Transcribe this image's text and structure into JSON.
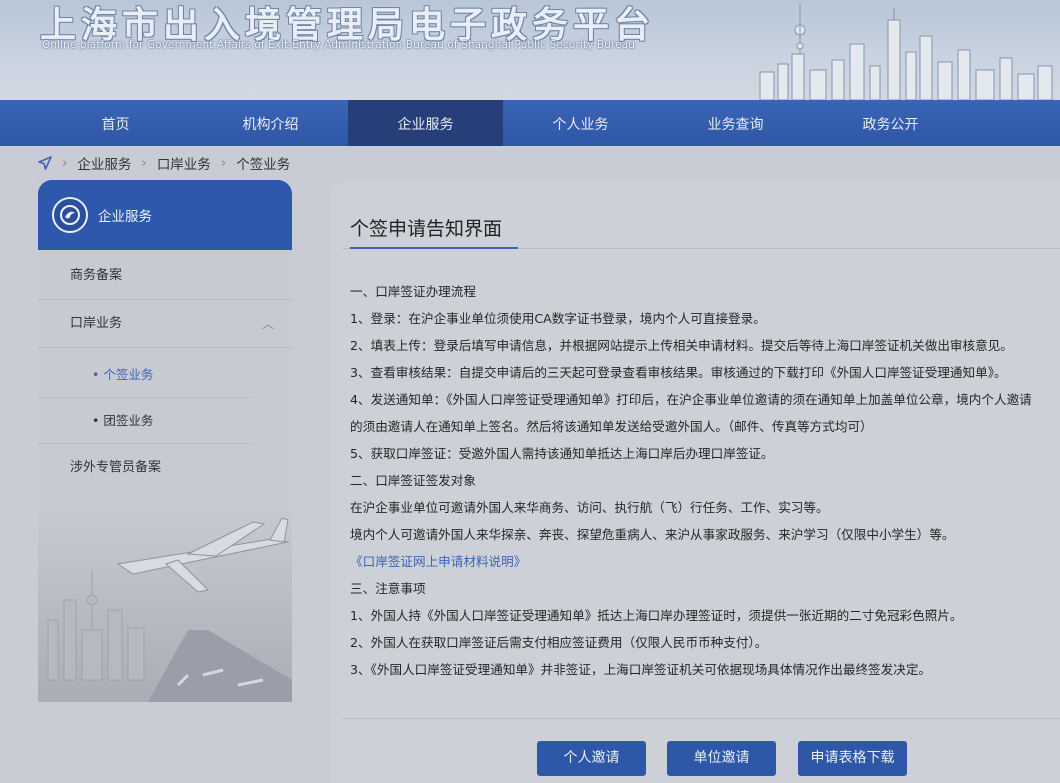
{
  "header": {
    "title_cn": "上海市出入境管理局电子政务平台",
    "title_en": "Online platform for Government Affairs of Exit-Entry Administration Bureau of Shanghai Public Security Bureau"
  },
  "nav": {
    "items": [
      {
        "label": "首页"
      },
      {
        "label": "机构介绍"
      },
      {
        "label": "企业服务"
      },
      {
        "label": "个人业务"
      },
      {
        "label": "业务查询"
      },
      {
        "label": "政务公开"
      }
    ],
    "active": "企业服务"
  },
  "breadcrumb": {
    "items": [
      "企业服务",
      "口岸业务",
      "个签业务"
    ],
    "icon": "location-arrow-icon"
  },
  "sidebar": {
    "title": "企业服务",
    "items": [
      {
        "label": "商务备案"
      },
      {
        "label": "口岸业务"
      },
      {
        "label": "• 个签业务"
      },
      {
        "label": "• 团签业务"
      },
      {
        "label": "涉外专管员备案"
      }
    ],
    "active": "• 个签业务"
  },
  "main": {
    "title": "个签申请告知界面",
    "lines": [
      "一、口岸签证办理流程",
      "1、登录：在沪企事业单位须使用CA数字证书登录，境内个人可直接登录。",
      "2、填表上传：登录后填写申请信息，并根据网站提示上传相关申请材料。提交后等待上海口岸签证机关做出审核意见。",
      "3、查看审核结果：自提交申请后的三天起可登录查看审核结果。审核通过的下载打印《外国人口岸签证受理通知单》。",
      "4、发送通知单：《外国人口岸签证受理通知单》打印后，在沪企事业单位邀请的须在通知单上加盖单位公章，境内个人邀请",
      "的须由邀请人在通知单上签名。然后将该通知单发送给受邀外国人。（邮件、传真等方式均可）",
      "5、获取口岸签证：受邀外国人需持该通知单抵达上海口岸后办理口岸签证。",
      "二、口岸签证签发对象",
      "在沪企事业单位可邀请外国人来华商务、访问、执行航（飞）行任务、工作、实习等。",
      "境内个人可邀请外国人来华探亲、奔丧、探望危重病人、来沪从事家政服务、来沪学习（仅限中小学生）等。",
      "《口岸签证网上申请材料说明》",
      "三、注意事项",
      "1、外国人持《外国人口岸签证受理通知单》抵达上海口岸办理签证时，须提供一张近期的二寸免冠彩色照片。",
      "2、外国人在获取口岸签证后需支付相应签证费用（仅限人民币币种支付）。",
      "3、《外国人口岸签证受理通知单》并非签证，上海口岸签证机关可依据现场具体情况作出最终签发决定。"
    ]
  },
  "buttons": {
    "personal_invite": "个人邀请",
    "unit_invite": "单位邀请",
    "form_download": "申请表格下载"
  },
  "colors": {
    "primary": "#2f57a8",
    "nav_active": "#273f78",
    "link": "#3e63b3"
  }
}
